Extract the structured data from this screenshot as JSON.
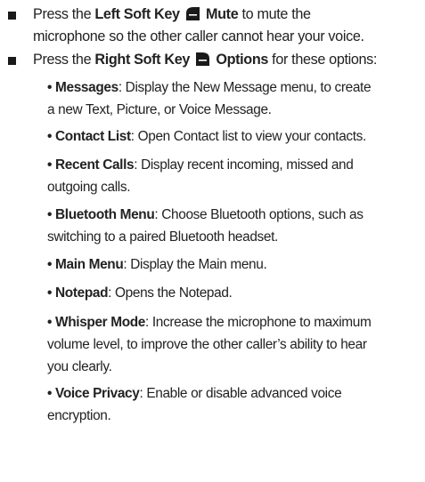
{
  "items": [
    {
      "pre": "Press the ",
      "key_label": "Left Soft Key",
      "key_icon": "left-soft-key-icon",
      "action_label": "Mute",
      "line1_rest": " to mute the",
      "line2": "microphone so the other caller cannot hear your voice."
    },
    {
      "pre": "Press the ",
      "key_label": "Right Soft Key",
      "key_icon": "right-soft-key-icon",
      "action_label": "Options",
      "line1_rest": " for these options:"
    }
  ],
  "options": [
    {
      "term": "Messages",
      "lines": [
        ": Display the New Message menu, to create",
        "a new Text, Picture, or Voice Message."
      ]
    },
    {
      "term": "Contact List",
      "lines": [
        ": Open Contact list to view your contacts."
      ]
    },
    {
      "term": "Recent Calls",
      "lines": [
        ": Display recent incoming, missed and",
        "outgoing calls."
      ]
    },
    {
      "term": "Bluetooth Menu",
      "lines": [
        ": Choose Bluetooth options, such as",
        "switching to a paired Bluetooth headset."
      ]
    },
    {
      "term": "Main Menu",
      "lines": [
        ": Display the Main menu."
      ]
    },
    {
      "term": "Notepad",
      "lines": [
        ": Opens the Notepad."
      ]
    },
    {
      "term": "Whisper Mode",
      "lines": [
        ": Increase the microphone to maximum",
        "volume level, to improve the other caller’s ability to hear",
        "you clearly."
      ]
    },
    {
      "term": "Voice Privacy",
      "lines": [
        ": Enable or disable advanced voice",
        "encryption."
      ]
    }
  ],
  "bullet_char": "•",
  "text_color": "#222222"
}
